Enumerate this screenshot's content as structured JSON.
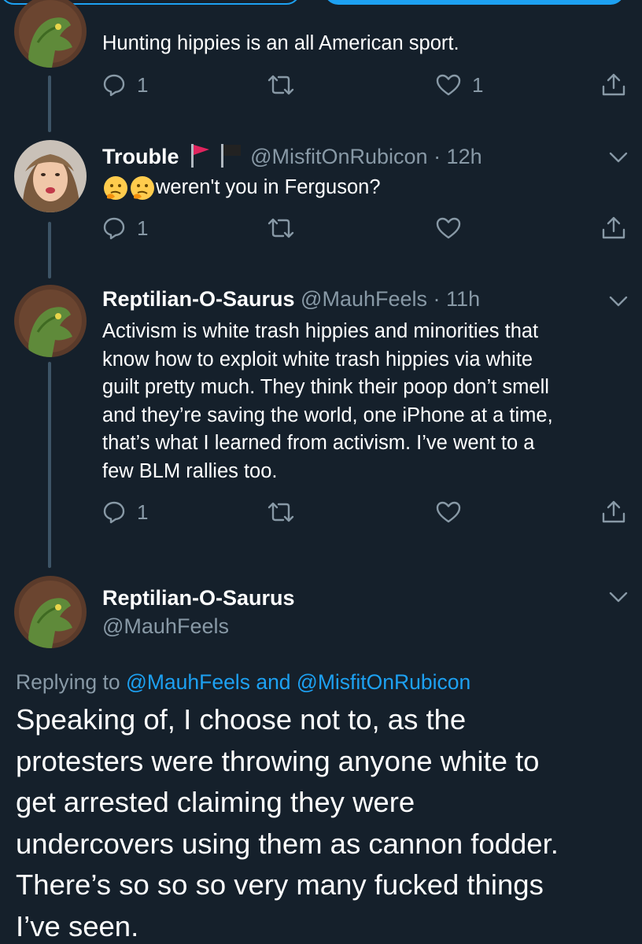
{
  "colors": {
    "background": "#15202b",
    "muted": "#8899a6",
    "accent": "#1da1f2",
    "text": "#ffffff"
  },
  "tweets": [
    {
      "text": "Hunting hippies is an all American sport.",
      "reply_count": "1",
      "like_count": "1"
    },
    {
      "name": "Trouble",
      "name_icons": [
        "red-flag-icon",
        "black-flag-icon"
      ],
      "handle": "@MisfitOnRubicon",
      "time": "· 12h",
      "emoji": [
        "thinking-face-icon",
        "thinking-face-icon"
      ],
      "text": "weren't you in Ferguson?",
      "reply_count": "1"
    },
    {
      "name": "Reptilian-O-Saurus",
      "handle": "@MauhFeels",
      "time": "· 11h",
      "text_lines": [
        "Activism is white trash hippies and minorities that",
        "know how to exploit white trash hippies via white",
        "guilt pretty much. They think their poop don’t smell",
        "and they’re saving the world, one iPhone at a time,",
        "that’s what I learned from activism. I’ve went to a",
        "few BLM rallies too."
      ],
      "reply_count": "1"
    }
  ],
  "focused_tweet": {
    "name": "Reptilian-O-Saurus",
    "handle": "@MauhFeels",
    "replying_prefix": "Replying to",
    "replying_user1": "@MauhFeels",
    "replying_and": "and",
    "replying_user2": "@MisfitOnRubicon",
    "text_lines": [
      "Speaking of, I choose not to, as the",
      "protesters were throwing anyone white to",
      "get arrested claiming they were",
      "undercovers using them as cannon fodder.",
      "There’s so so so very many fucked things",
      "I’ve seen."
    ]
  }
}
